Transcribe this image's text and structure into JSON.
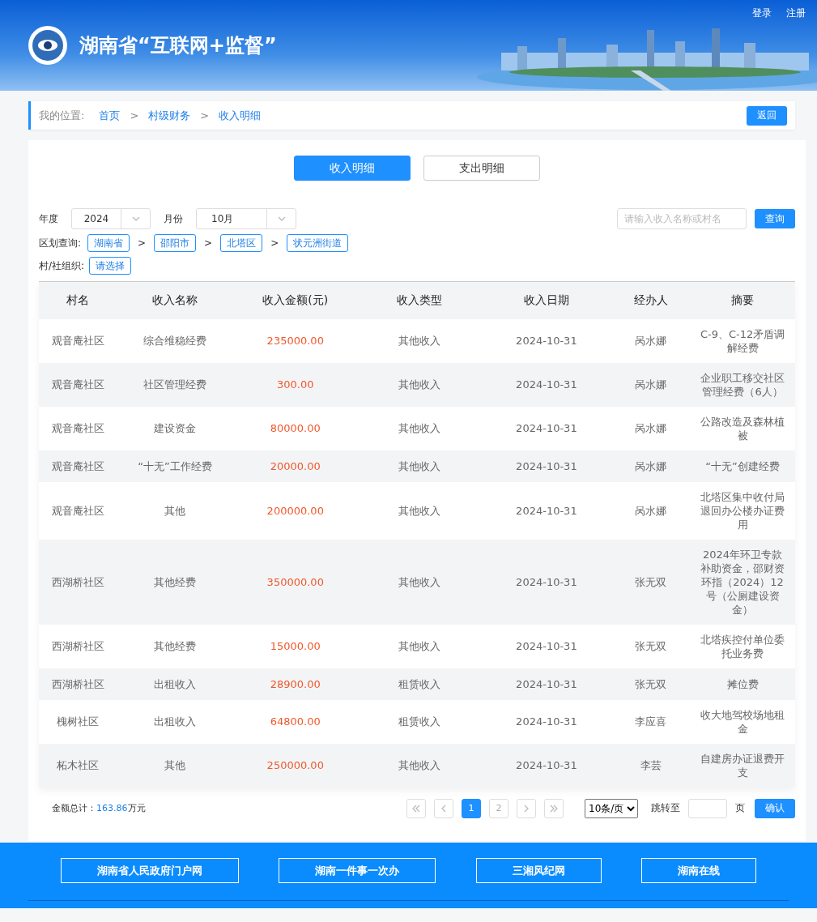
{
  "header": {
    "title": "湖南省“互联网+监督”",
    "links": [
      "登录",
      "注册"
    ]
  },
  "breadcrumb": {
    "label": "我的位置:",
    "items": [
      {
        "kind": "link",
        "text": "首页"
      },
      {
        "kind": "sep",
        "text": ">"
      },
      {
        "kind": "link",
        "text": "村级财务"
      },
      {
        "kind": "sep",
        "text": ">"
      },
      {
        "kind": "link",
        "text": "收入明细"
      }
    ],
    "back": "返回"
  },
  "tabs": [
    {
      "label": "收入明细",
      "selected": true
    },
    {
      "label": "支出明细",
      "selected": false
    }
  ],
  "filters": {
    "year": {
      "label": "年度",
      "value": "2024"
    },
    "month": {
      "label": "月份",
      "value": "10月"
    },
    "search": {
      "placeholder": "请输入收入名称或村名"
    },
    "query": "查询",
    "region": {
      "label": "区划查询:",
      "items": [
        {
          "kind": "chip",
          "text": "湖南省"
        },
        {
          "kind": "sep",
          "text": ">"
        },
        {
          "kind": "chip",
          "text": "邵阳市"
        },
        {
          "kind": "sep",
          "text": ">"
        },
        {
          "kind": "chip",
          "text": "北塔区"
        },
        {
          "kind": "sep",
          "text": ">"
        },
        {
          "kind": "chip",
          "text": "状元洲街道"
        }
      ]
    },
    "org": {
      "label": "村/社组织:",
      "value": "请选择"
    }
  },
  "table": {
    "columns": [
      "村名",
      "收入名称",
      "收入金额(元)",
      "收入类型",
      "收入日期",
      "经办人",
      "摘要"
    ],
    "rows": [
      [
        "观音庵社区",
        "综合维稳经费",
        "235000.00",
        "其他收入",
        "2024-10-31",
        "呙水娜",
        "C-9、C-12矛盾调解经费"
      ],
      [
        "观音庵社区",
        "社区管理经费",
        "300.00",
        "其他收入",
        "2024-10-31",
        "呙水娜",
        "企业职工移交社区管理经费（6人）"
      ],
      [
        "观音庵社区",
        "建设资金",
        "80000.00",
        "其他收入",
        "2024-10-31",
        "呙水娜",
        "公路改造及森林植被"
      ],
      [
        "观音庵社区",
        "“十无”工作经费",
        "20000.00",
        "其他收入",
        "2024-10-31",
        "呙水娜",
        "“十无”创建经费"
      ],
      [
        "观音庵社区",
        "其他",
        "200000.00",
        "其他收入",
        "2024-10-31",
        "呙水娜",
        "北塔区集中收付局退回办公楼办证费用"
      ],
      [
        "西湖桥社区",
        "其他经费",
        "350000.00",
        "其他收入",
        "2024-10-31",
        "张无双",
        "2024年环卫专款补助资金，邵财资环指（2024）12号（公厕建设资金）"
      ],
      [
        "西湖桥社区",
        "其他经费",
        "15000.00",
        "其他收入",
        "2024-10-31",
        "张无双",
        "北塔疾控付单位委托业务费"
      ],
      [
        "西湖桥社区",
        "出租收入",
        "28900.00",
        "租赁收入",
        "2024-10-31",
        "张无双",
        "摊位费"
      ],
      [
        "槐树社区",
        "出租收入",
        "64800.00",
        "租赁收入",
        "2024-10-31",
        "李应喜",
        "收大地驾校场地租金"
      ],
      [
        "柘木社区",
        "其他",
        "250000.00",
        "其他收入",
        "2024-10-31",
        "李芸",
        "自建房办证退费开支"
      ]
    ]
  },
  "summary": {
    "label": "金额总计：",
    "value": "163.86",
    "unit": "万元"
  },
  "pagination": {
    "pages": [
      {
        "label": "1",
        "selected": true
      },
      {
        "label": "2",
        "selected": false
      }
    ],
    "page_size": "10条/页",
    "jump_label": "跳转至",
    "page_unit": "页",
    "confirm": "确认"
  },
  "footer": {
    "links": [
      "湖南省人民政府门户网",
      "湖南一件事一次办",
      "三湘风纪网",
      "湖南在线"
    ]
  }
}
